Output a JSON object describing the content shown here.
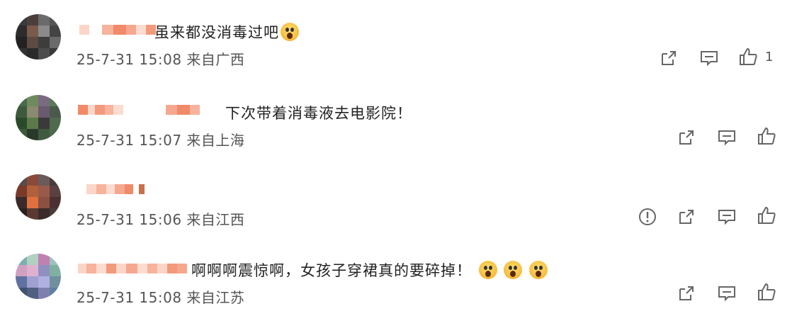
{
  "comments": [
    {
      "text": "虽来都没消毒过吧",
      "emojis": 1,
      "date": "25-7-31 15:08",
      "location": "来自广西",
      "like_count": "1",
      "has_report": false
    },
    {
      "text": "下次带着消毒液去电影院！",
      "emojis": 0,
      "date": "25-7-31 15:07",
      "location": "来自上海",
      "like_count": "",
      "has_report": false
    },
    {
      "text": "",
      "emojis": 0,
      "date": "25-7-31 15:06",
      "location": "来自江西",
      "like_count": "",
      "has_report": true
    },
    {
      "text": "啊啊啊震惊啊，女孩子穿裙真的要碎掉！",
      "emojis": 3,
      "date": "25-7-31 15:08",
      "location": "来自江苏",
      "like_count": "",
      "has_report": false
    }
  ],
  "icons": {
    "share": "share-icon",
    "comment": "comment-icon",
    "like": "thumbs-up-icon",
    "report": "report-icon"
  },
  "colors": {
    "text": "#222222",
    "meta": "#555555",
    "icon": "#666666",
    "emoji": "#f6b93b"
  }
}
